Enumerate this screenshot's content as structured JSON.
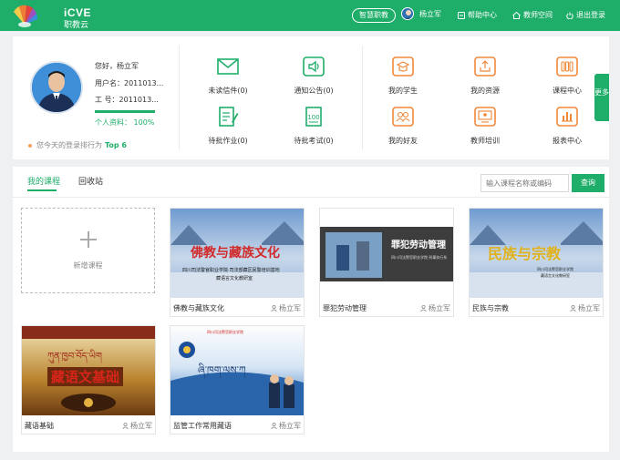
{
  "header": {
    "logo_en": "iCVE",
    "logo_cn": "职教云",
    "wisdom_label": "智慧职教",
    "user_name": "杨立军",
    "help_label": "帮助中心",
    "teacher_space_label": "教师空间",
    "logout_label": "退出登录",
    "brand_color": "#1fae6a"
  },
  "profile": {
    "greeting": "您好，杨立军",
    "username_line": "用户名：2011013...",
    "staff_no_line": "工    号：2011013...",
    "completeness": "个人资料： 100%",
    "completeness_value": 1.0,
    "rank_prefix": "您今天的登录排行为",
    "rank_value": "Top 6"
  },
  "quick_links": [
    {
      "label": "未读信件(0)",
      "icon": "mail-icon"
    },
    {
      "label": "通知公告(0)",
      "icon": "speaker-icon"
    },
    {
      "label": "待批作业(0)",
      "icon": "homework-icon"
    },
    {
      "label": "待批考试(0)",
      "icon": "exam-icon"
    },
    {
      "label": "我的学生",
      "icon": "student-icon"
    },
    {
      "label": "我的资源",
      "icon": "resource-icon"
    },
    {
      "label": "课程中心",
      "icon": "course-center-icon"
    },
    {
      "label": "我的好友",
      "icon": "friends-icon"
    },
    {
      "label": "教师培训",
      "icon": "training-icon"
    },
    {
      "label": "报表中心",
      "icon": "report-icon"
    }
  ],
  "more_label": "更多",
  "courses": {
    "tab_mine": "我的课程",
    "tab_recycle": "回收站",
    "search_placeholder": "输入课程名称或编码",
    "search_button": "查询",
    "add_label": "新增课程",
    "items": [
      {
        "title": "佛教与藏族文化",
        "owner": "杨立军",
        "cover_title": "佛教与藏族文化",
        "cover_sub": "四川司法警官职业学院·司法部藏区民警培训基地",
        "cover_sub2": "藏语言文化教研室"
      },
      {
        "title": "罪犯劳动管理",
        "owner": "杨立军",
        "cover_title": "罪犯劳动管理",
        "cover_sub": "四川司法警官职业学院 刑事执行系"
      },
      {
        "title": "民族与宗教",
        "owner": "杨立军",
        "cover_title": "民族与宗教",
        "cover_sub": "四川司法警官职业学院",
        "cover_sub2": "藏语言文化教研室"
      },
      {
        "title": "藏语基础",
        "owner": "杨立军",
        "cover_title": "藏语文基础",
        "cover_sub": "ཀུན་ཁྱབ་བོད་ཡིག"
      },
      {
        "title": "监管工作常用藏语",
        "owner": "杨立军",
        "cover_title": "ཞི་ཁག་ལས་ཀ",
        "cover_sub": "四川司法警官职业学院"
      }
    ]
  }
}
